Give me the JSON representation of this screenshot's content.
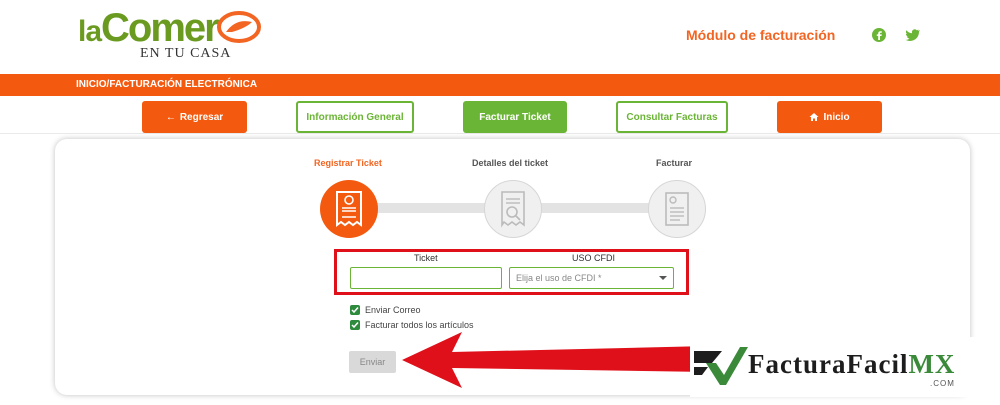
{
  "header": {
    "logo_word_a": "la",
    "logo_word_b": "Comer",
    "logo_sub": "EN TU CASA",
    "module_title": "Módulo de facturación",
    "icons": [
      "facebook-icon",
      "twitter-icon"
    ]
  },
  "breadcrumb": "INICIO/FACTURACIÓN ELECTRÓNICA",
  "nav": {
    "regresar": "Regresar",
    "info_general": "Información General",
    "facturar_ticket": "Facturar Ticket",
    "consultar_facturas": "Consultar Facturas",
    "inicio": "Inicio"
  },
  "steps": [
    {
      "label": "Registrar Ticket",
      "active": true
    },
    {
      "label": "Detalles del ticket",
      "active": false
    },
    {
      "label": "Facturar",
      "active": false
    }
  ],
  "form": {
    "ticket_label": "Ticket",
    "ticket_value": "",
    "cfdi_label": "USO CFDI",
    "cfdi_placeholder": "Elija el uso de CFDI *"
  },
  "options": {
    "enviar_correo": "Enviar Correo",
    "facturar_todos": "Facturar todos los artículos"
  },
  "submit_label": "Enviar",
  "watermark": {
    "name_a": "FacturaFacil",
    "name_b": "MX",
    "domain": ".COM"
  },
  "colors": {
    "brand_orange": "#f45a0f",
    "brand_green": "#6bb536",
    "highlight_red": "#e0101a"
  }
}
